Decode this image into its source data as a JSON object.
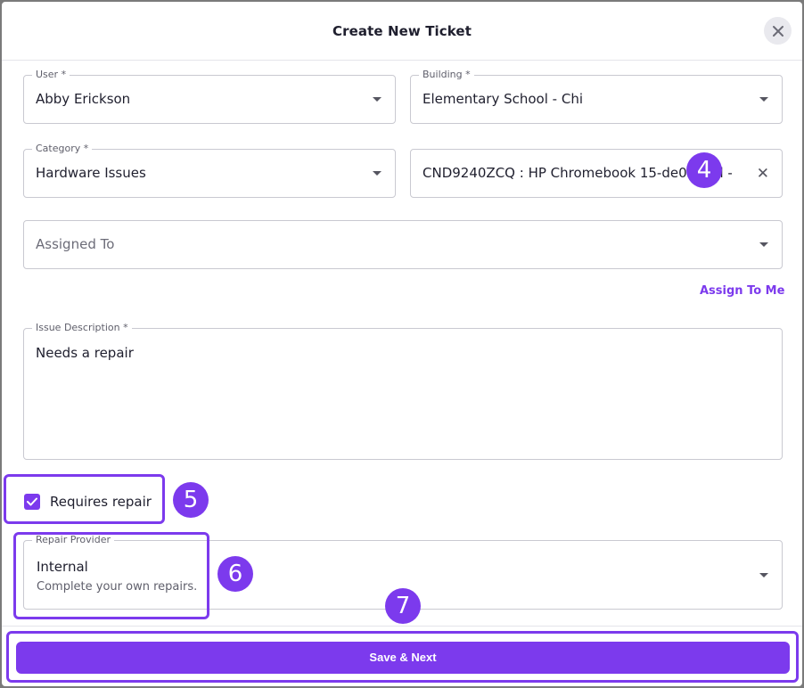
{
  "modal": {
    "title": "Create New Ticket",
    "close_icon": "close-icon"
  },
  "fields": {
    "user": {
      "label": "User *",
      "value": "Abby Erickson"
    },
    "building": {
      "label": "Building *",
      "value": "Elementary School - Chi"
    },
    "category": {
      "label": "Category *",
      "value": "Hardware Issues"
    },
    "device": {
      "value": "CND9240ZCQ : HP Chromebook 15-de0015cl -"
    },
    "assigned_to": {
      "placeholder": "Assigned To"
    },
    "issue_description": {
      "label": "Issue Description *",
      "value": "Needs a repair"
    },
    "repair_provider": {
      "label": "Repair Provider",
      "value": "Internal",
      "description": "Complete your own repairs."
    }
  },
  "assign_to_me_label": "Assign To Me",
  "requires_repair": {
    "label": "Requires repair",
    "checked": true
  },
  "save_button_label": "Save & Next",
  "callouts": {
    "four": "4",
    "five": "5",
    "six": "6",
    "seven": "7"
  },
  "colors": {
    "accent": "#7c3aed",
    "border": "#c9c9d1",
    "text": "#1f1f2e"
  }
}
